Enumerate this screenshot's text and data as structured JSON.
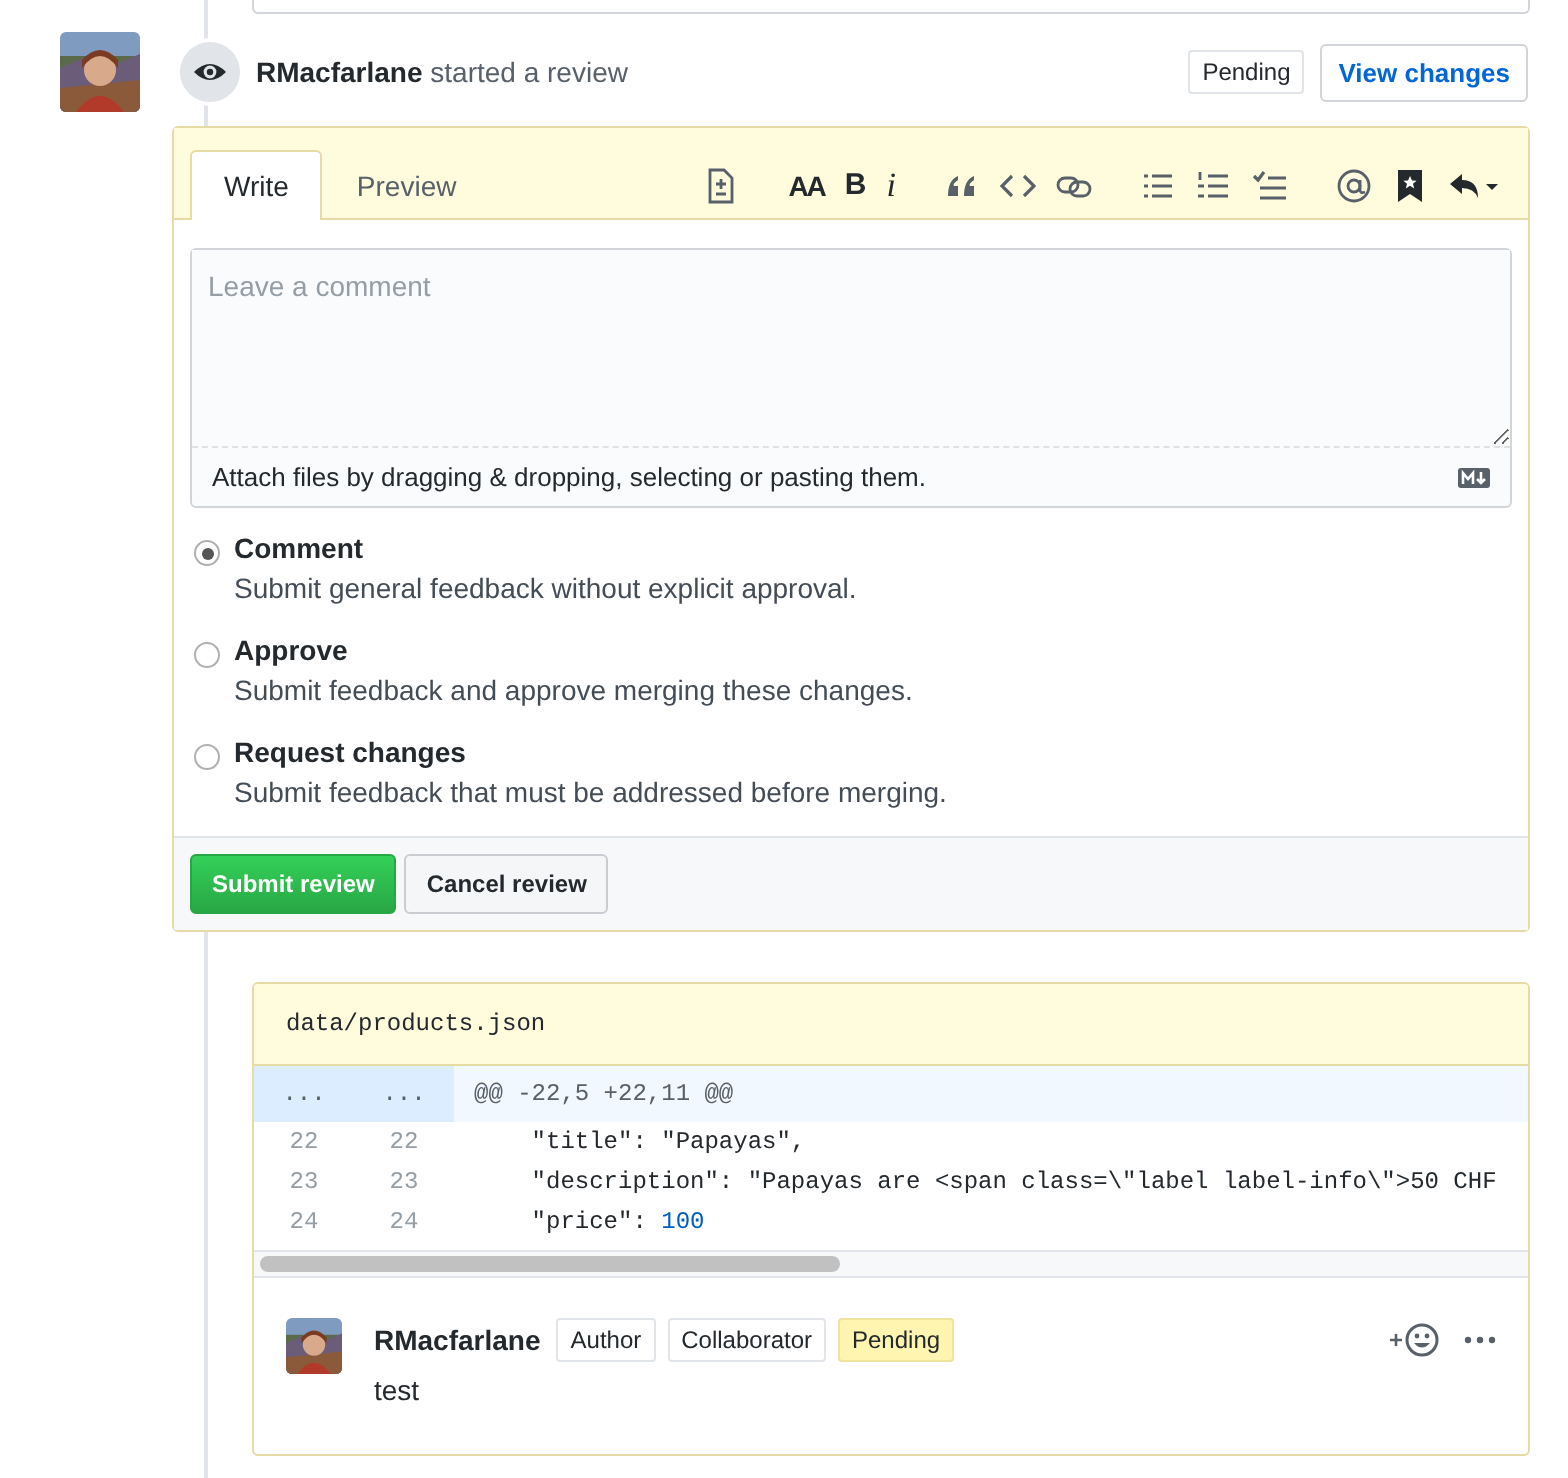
{
  "review_event": {
    "author": "RMacfarlane",
    "action": "started a review",
    "badge": "Pending",
    "button": "View changes"
  },
  "review_form": {
    "tabs": [
      {
        "label": "Write",
        "selected": true
      },
      {
        "label": "Preview",
        "selected": false
      }
    ],
    "toolbar": [
      {
        "kind": "file"
      },
      {
        "kind": "heading",
        "label": "AA"
      },
      {
        "kind": "bold",
        "label": "B"
      },
      {
        "kind": "italic",
        "label": "i"
      },
      {
        "kind": "quote"
      },
      {
        "kind": "code"
      },
      {
        "kind": "link"
      },
      {
        "kind": "ul"
      },
      {
        "kind": "ol"
      },
      {
        "kind": "tasks"
      },
      {
        "kind": "mention"
      },
      {
        "kind": "bookmark"
      },
      {
        "kind": "reply"
      }
    ],
    "comment": {
      "placeholder": "Leave a comment",
      "attach_hint": "Attach files by dragging & dropping, selecting or pasting them."
    },
    "options": [
      {
        "label": "Comment",
        "description": "Submit general feedback without explicit approval.",
        "selected": true
      },
      {
        "label": "Approve",
        "description": "Submit feedback and approve merging these changes.",
        "selected": false
      },
      {
        "label": "Request changes",
        "description": "Submit feedback that must be addressed before merging.",
        "selected": false
      }
    ],
    "buttons": [
      {
        "label": "Submit review",
        "kind": "primary"
      },
      {
        "label": "Cancel review",
        "kind": "secondary"
      }
    ]
  },
  "diff": {
    "file": "data/products.json",
    "hunk": {
      "old": "...",
      "new": "...",
      "text": "@@ -22,5 +22,11 @@"
    },
    "lines": [
      {
        "old": "22",
        "new": "22",
        "segments": [
          {
            "text": "    \"title\": \"Papayas\",",
            "kind": "plain"
          }
        ]
      },
      {
        "old": "23",
        "new": "23",
        "segments": [
          {
            "text": "    \"description\": \"Papayas are <span class=\\\"label label-info\\\">50 CHF",
            "kind": "plain"
          }
        ]
      },
      {
        "old": "24",
        "new": "24",
        "segments": [
          {
            "text": "    \"price\": ",
            "kind": "plain"
          },
          {
            "text": "100",
            "kind": "number"
          }
        ]
      }
    ],
    "comment": {
      "author": "RMacfarlane",
      "labels": [
        {
          "text": "Author",
          "kind": "plain"
        },
        {
          "text": "Collaborator",
          "kind": "plain"
        },
        {
          "text": "Pending",
          "kind": "pending"
        }
      ],
      "body": "test"
    }
  }
}
